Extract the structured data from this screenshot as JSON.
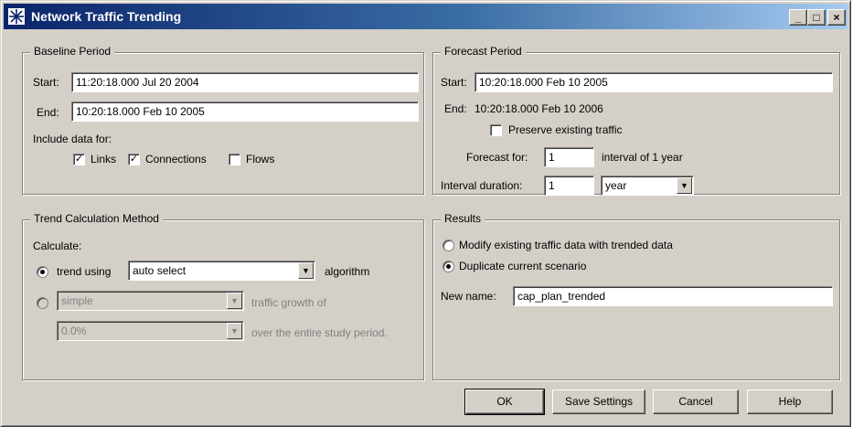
{
  "window": {
    "title": "Network Traffic Trending",
    "minimize": "_",
    "maximize": "□",
    "close": "×"
  },
  "baseline": {
    "legend": "Baseline Period",
    "start_label": "Start:",
    "start_value": "11:20:18.000 Jul 20 2004",
    "end_label": "End:",
    "end_value": "10:20:18.000 Feb 10 2005",
    "include_label": "Include data for:",
    "links": {
      "label": "Links",
      "checked": true
    },
    "connections": {
      "label": "Connections",
      "checked": true
    },
    "flows": {
      "label": "Flows",
      "checked": false
    }
  },
  "forecast": {
    "legend": "Forecast Period",
    "start_label": "Start:",
    "start_value": "10:20:18.000 Feb 10 2005",
    "end_label": "End:",
    "end_value": "10:20:18.000 Feb 10 2006",
    "preserve": {
      "label": "Preserve existing traffic",
      "checked": false
    },
    "forecast_for_label": "Forecast for:",
    "forecast_for_value": "1",
    "interval_text": "interval of 1 year",
    "interval_duration_label": "Interval duration:",
    "interval_duration_value": "1",
    "interval_unit": "year"
  },
  "trend": {
    "legend": "Trend Calculation Method",
    "calculate_label": "Calculate:",
    "option1_label": "trend using",
    "option1_selected": true,
    "algorithm_value": "auto select",
    "algorithm_suffix": "algorithm",
    "option2_selected": false,
    "growth_type_value": "simple",
    "growth_suffix": "traffic growth of",
    "growth_value": "0.0%",
    "growth_period_suffix": "over the entire study period."
  },
  "results": {
    "legend": "Results",
    "modify_label": "Modify existing traffic data with trended data",
    "modify_selected": false,
    "duplicate_label": "Duplicate current scenario",
    "duplicate_selected": true,
    "new_name_label": "New name:",
    "new_name_value": "cap_plan_trended"
  },
  "buttons": {
    "ok": "OK",
    "save": "Save Settings",
    "cancel": "Cancel",
    "help": "Help"
  }
}
